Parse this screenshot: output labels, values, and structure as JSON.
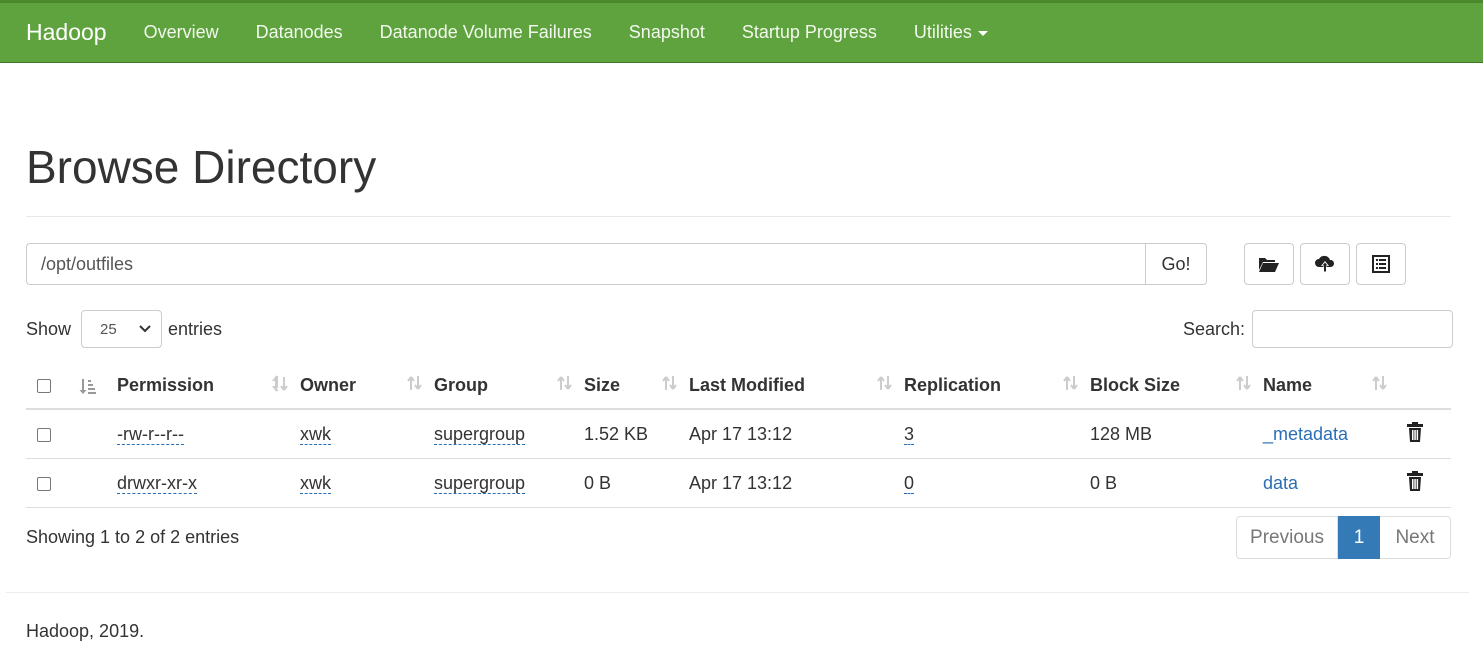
{
  "nav": {
    "brand": "Hadoop",
    "items": [
      "Overview",
      "Datanodes",
      "Datanode Volume Failures",
      "Snapshot",
      "Startup Progress",
      "Utilities"
    ]
  },
  "page": {
    "title": "Browse Directory"
  },
  "path": {
    "value": "/opt/outfiles",
    "go_label": "Go!"
  },
  "toolbar": {
    "icons": [
      "folder-open-icon",
      "cloud-upload-icon",
      "list-alt-icon"
    ]
  },
  "length": {
    "show_label": "Show",
    "value": "25",
    "entries_label": "entries"
  },
  "search": {
    "label": "Search:",
    "value": ""
  },
  "table": {
    "headers": [
      "Permission",
      "Owner",
      "Group",
      "Size",
      "Last Modified",
      "Replication",
      "Block Size",
      "Name"
    ],
    "rows": [
      {
        "permission": "-rw-r--r--",
        "owner": "xwk",
        "group": "supergroup",
        "size": "1.52 KB",
        "modified": "Apr 17 13:12",
        "replication": "3",
        "block_size": "128 MB",
        "name": "_metadata"
      },
      {
        "permission": "drwxr-xr-x",
        "owner": "xwk",
        "group": "supergroup",
        "size": "0 B",
        "modified": "Apr 17 13:12",
        "replication": "0",
        "block_size": "0 B",
        "name": "data"
      }
    ]
  },
  "info": "Showing 1 to 2 of 2 entries",
  "pagination": {
    "previous": "Previous",
    "current": "1",
    "next": "Next"
  },
  "footer": "Hadoop, 2019.",
  "colors": {
    "navbar": "#5fa33e",
    "link": "#2a6fb5",
    "active_page": "#337ab7"
  }
}
